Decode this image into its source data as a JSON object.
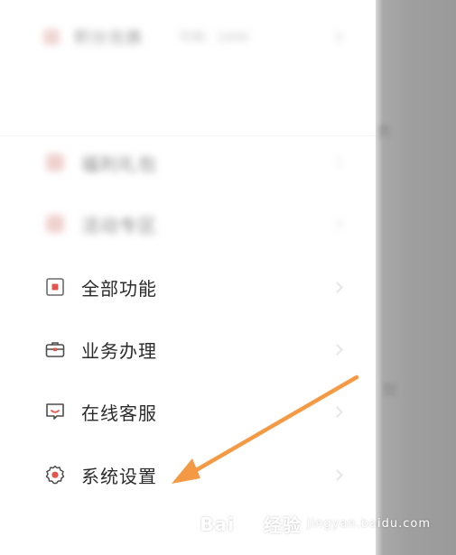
{
  "drawer": {
    "top_item": {
      "title": "积分兑换",
      "sub": "可用：1000",
      "icon": "gift-icon"
    },
    "blurred_items": [
      {
        "label": "福利礼包",
        "icon": "gift-box-icon"
      },
      {
        "label": "活动专区",
        "icon": "activity-icon"
      }
    ],
    "items": [
      {
        "label": "全部功能",
        "icon": "grid-app-icon"
      },
      {
        "label": "业务办理",
        "icon": "briefcase-icon"
      },
      {
        "label": "在线客服",
        "icon": "chat-service-icon"
      },
      {
        "label": "系统设置",
        "icon": "gear-icon"
      }
    ]
  },
  "overlay": {
    "ghost_text_1": "务",
    "ghost_text_2": "版"
  },
  "annotation": {
    "arrow_color": "#f59a44",
    "points_to": "系统设置"
  },
  "watermark": {
    "brand_a": "Bai",
    "brand_b": "经验",
    "brand_c": "jingyan.baidu.com"
  },
  "colors": {
    "accent": "#e5544b",
    "overlay": "#9c9c9c",
    "arrow": "#f59a44"
  }
}
